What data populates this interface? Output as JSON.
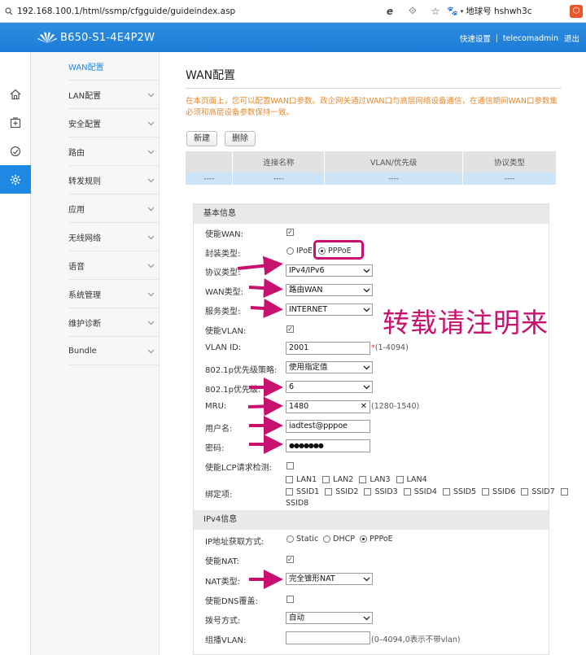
{
  "browser": {
    "url": "192.168.100.1/html/ssmp/cfgguide/guideindex.asp",
    "user": "地球号 hshwh3c"
  },
  "header": {
    "model": "B650-S1-4E4P2W",
    "links": [
      "快速设置",
      "telecomadmin",
      "退出"
    ]
  },
  "sidebar": {
    "items": [
      {
        "label": "WAN配置"
      },
      {
        "label": "LAN配置"
      },
      {
        "label": "安全配置"
      },
      {
        "label": "路由"
      },
      {
        "label": "转发规则"
      },
      {
        "label": "应用"
      },
      {
        "label": "无线网络"
      },
      {
        "label": "语音"
      },
      {
        "label": "系统管理"
      },
      {
        "label": "维护诊断"
      },
      {
        "label": "Bundle"
      }
    ]
  },
  "main": {
    "title": "WAN配置",
    "notice": "在本页面上，您可以配置WAN口参数。政企网关通过WAN口与高层网络设备通信，在通信期间WAN口参数集必须和高层设备参数保持一致。",
    "buttons": {
      "new": "新建",
      "delete": "删除"
    },
    "table": {
      "headers": [
        "",
        "连接名称",
        "VLAN/优先级",
        "协议类型"
      ],
      "rows": [
        [
          "----",
          "----",
          "----",
          "----"
        ]
      ]
    }
  },
  "form": {
    "basic": {
      "section": "基本信息",
      "enable_wan": {
        "label": "使能WAN:",
        "checked": true
      },
      "encap": {
        "label": "封装类型:",
        "options": [
          "IPoE",
          "PPPoE"
        ],
        "selected": "PPPoE"
      },
      "protocol": {
        "label": "协议类型:",
        "value": "IPv4/IPv6"
      },
      "wan_type": {
        "label": "WAN类型:",
        "value": "路由WAN"
      },
      "service": {
        "label": "服务类型:",
        "value": "INTERNET"
      },
      "enable_vlan": {
        "label": "使能VLAN:",
        "checked": true
      },
      "vlan_id": {
        "label": "VLAN ID:",
        "value": "2001",
        "hint": "(1-4094)"
      },
      "p8021_policy": {
        "label": "802.1p优先级策略:",
        "value": "使用指定值"
      },
      "p8021": {
        "label": "802.1p优先级:",
        "value": "6"
      },
      "mru": {
        "label": "MRU:",
        "value": "1480",
        "hint": "(1280-1540)"
      },
      "username": {
        "label": "用户名:",
        "value": "iadtest@pppoe"
      },
      "password": {
        "label": "密码:",
        "value": "●●●●●●●"
      },
      "lcp": {
        "label": "使能LCP请求检测:",
        "checked": false
      },
      "bind": {
        "label": "绑定项:",
        "lan": [
          "LAN1",
          "LAN2",
          "LAN3",
          "LAN4"
        ],
        "ssid_line1": [
          "SSID1",
          "SSID2",
          "SSID3",
          "SSID4",
          "SSID5",
          "SSID6",
          "SSID7"
        ],
        "ssid_line2": [
          "SSID8"
        ]
      }
    },
    "ipv4": {
      "section": "IPv4信息",
      "addr_mode": {
        "label": "IP地址获取方式:",
        "options": [
          "Static",
          "DHCP",
          "PPPoE"
        ],
        "selected": "PPPoE"
      },
      "nat": {
        "label": "使能NAT:",
        "checked": true
      },
      "nat_type": {
        "label": "NAT类型:",
        "value": "完全锥形NAT"
      },
      "dns": {
        "label": "使能DNS覆盖:",
        "checked": false
      },
      "dial": {
        "label": "拨号方式:",
        "value": "自动"
      },
      "mvlan": {
        "label": "组播VLAN:",
        "value": "",
        "hint": "(0–4094,0表示不带vlan)"
      }
    }
  },
  "watermark": "转载请注明来",
  "colors": {
    "header": "#1e88e5",
    "accent": "#c8106e",
    "notice": "#e5892f"
  }
}
